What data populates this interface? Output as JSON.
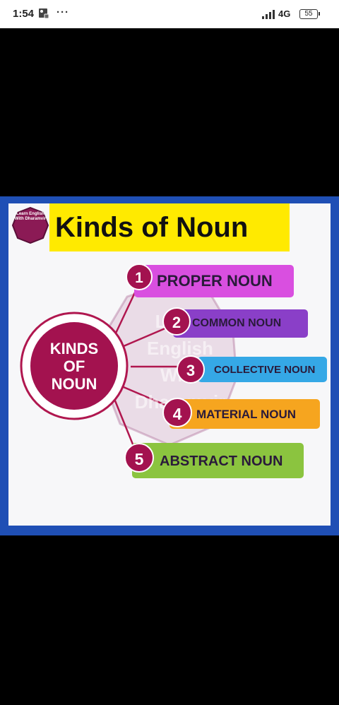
{
  "status_bar": {
    "time": "1:54",
    "more": "···",
    "network": "4G",
    "battery": "55"
  },
  "poster": {
    "badge_text": "Learn English With Dharamvir",
    "title": "Kinds of Noun",
    "hub_label": "KINDS\nOF\nNOUN",
    "watermark": "Learn\nEnglish\nWith\nDharamvir",
    "items": [
      {
        "number": "1",
        "label": "PROPER NOUN",
        "color": "#d94fe0"
      },
      {
        "number": "2",
        "label": "COMMON NOUN",
        "color": "#8a3fc8"
      },
      {
        "number": "3",
        "label": "COLLECTIVE NOUN",
        "color": "#35a8e6"
      },
      {
        "number": "4",
        "label": "MATERIAL NOUN",
        "color": "#f6a51f"
      },
      {
        "number": "5",
        "label": "ABSTRACT NOUN",
        "color": "#8bc43f"
      }
    ]
  },
  "colors": {
    "frame": "#1f4fb5",
    "title_band": "#ffea00",
    "hub": "#a3124f",
    "number_circle": "#a3124f"
  }
}
